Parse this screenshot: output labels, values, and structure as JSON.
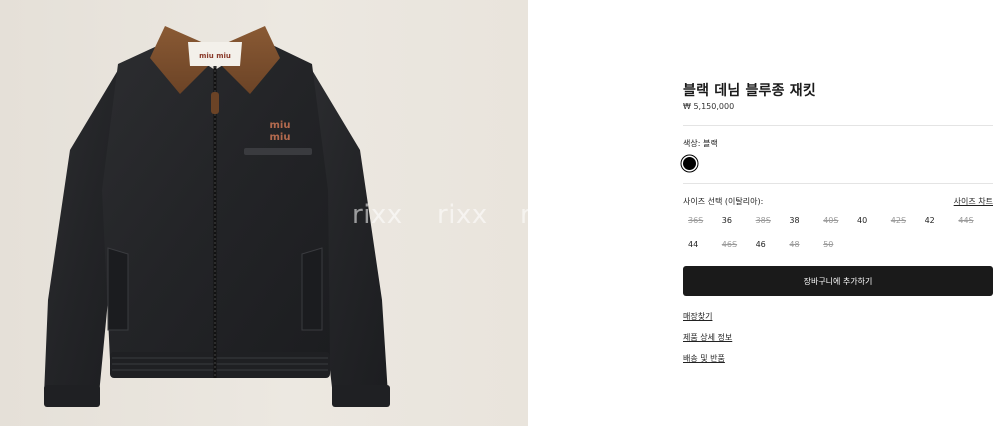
{
  "product": {
    "title": "블랙 데님 블루종 재킷",
    "price": "₩ 5,150,000",
    "image_alt_brand": "miu miu",
    "watermark": [
      "rixx",
      "rixx",
      "r"
    ]
  },
  "color": {
    "label": "색상:  블랙",
    "swatch_color": "#000000"
  },
  "size": {
    "label": "사이즈 선택 (이탈리아):",
    "chart_link": "사이즈 차트",
    "options": [
      {
        "label": "36S",
        "available": false
      },
      {
        "label": "36",
        "available": true
      },
      {
        "label": "38S",
        "available": false
      },
      {
        "label": "38",
        "available": true
      },
      {
        "label": "40S",
        "available": false
      },
      {
        "label": "40",
        "available": true
      },
      {
        "label": "42S",
        "available": false
      },
      {
        "label": "42",
        "available": true
      },
      {
        "label": "44S",
        "available": false
      },
      {
        "label": "44",
        "available": true
      },
      {
        "label": "46S",
        "available": false
      },
      {
        "label": "46",
        "available": true
      },
      {
        "label": "48",
        "available": false
      },
      {
        "label": "50",
        "available": false
      }
    ]
  },
  "actions": {
    "add_to_cart": "장바구니에 추가하기",
    "store_finder": "매장찾기",
    "product_details": "제품 상세 정보",
    "shipping_returns": "배송 및 반품"
  }
}
